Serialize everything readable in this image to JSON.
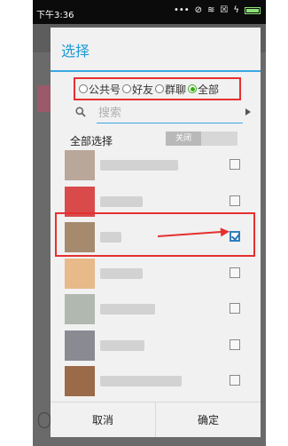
{
  "statusbar": {
    "time": "下午3:36",
    "icons": [
      "dots-icon",
      "mute-icon",
      "wifi-icon",
      "close-box-icon",
      "charging-icon",
      "battery-icon"
    ]
  },
  "dialog": {
    "title": "选择",
    "filter": {
      "options": [
        "公共号",
        "好友",
        "群聊",
        "全部"
      ],
      "selected": "全部"
    },
    "search": {
      "placeholder": "搜索"
    },
    "select_all": {
      "label": "全部选择",
      "toggle_label": "关闭",
      "value": "off"
    },
    "contacts": [
      {
        "checked": false,
        "avatar_color": "#b9a79a"
      },
      {
        "checked": false,
        "avatar_color": "#d94a4a"
      },
      {
        "checked": true,
        "avatar_color": "#a58a6e"
      },
      {
        "checked": false,
        "avatar_color": "#e8b989"
      },
      {
        "checked": false,
        "avatar_color": "#b0b8b0"
      },
      {
        "checked": false,
        "avatar_color": "#8a8a92"
      },
      {
        "checked": false,
        "avatar_color": "#9b6a48"
      }
    ],
    "buttons": {
      "cancel": "取消",
      "confirm": "确定"
    }
  },
  "colors": {
    "accent": "#1e9bd7",
    "annotation": "#e53030",
    "radio_selected": "#3aaa1a"
  }
}
